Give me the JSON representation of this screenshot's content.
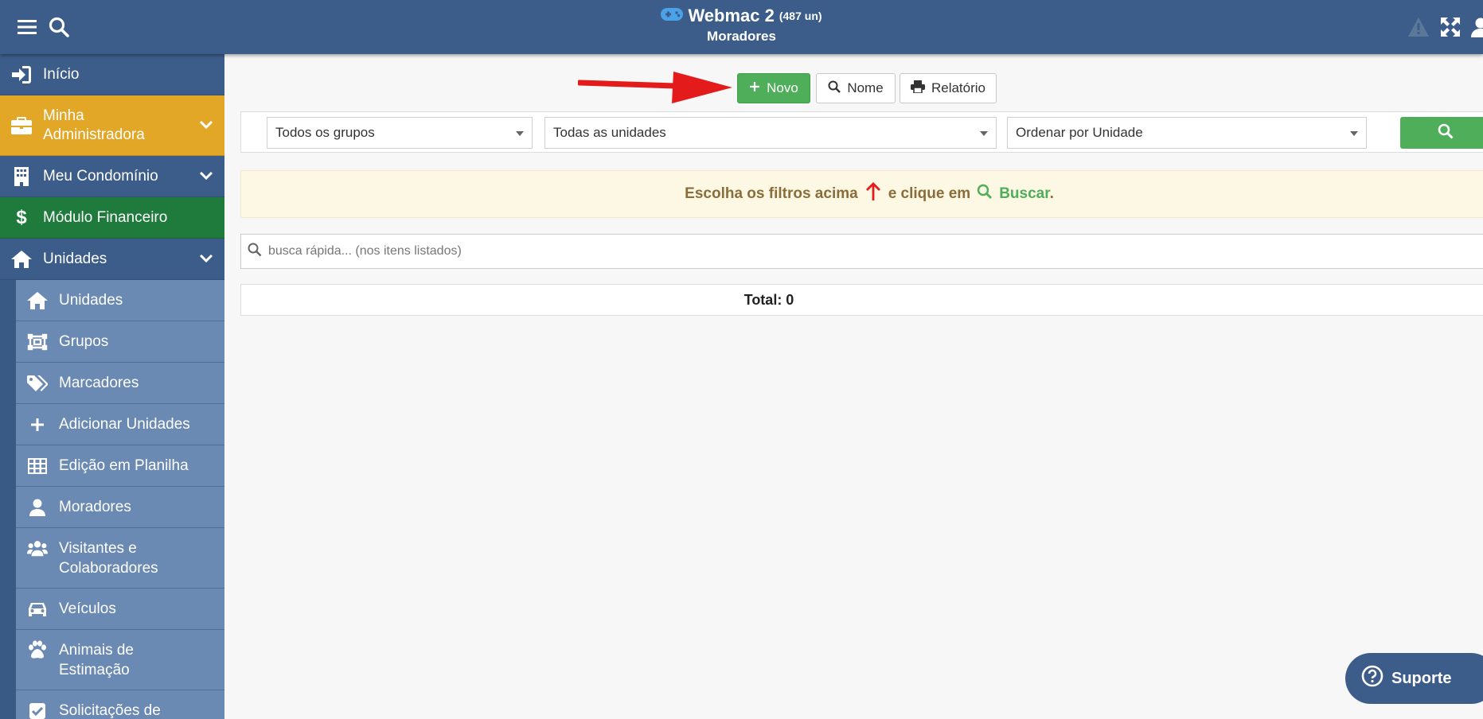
{
  "header": {
    "app_name": "Webmac 2",
    "units_count": "(487 un)",
    "page_title": "Moradores"
  },
  "sidebar": {
    "items": [
      {
        "label": "Início"
      },
      {
        "label": "Minha Administradora"
      },
      {
        "label": "Meu Condomínio"
      },
      {
        "label": "Módulo Financeiro"
      },
      {
        "label": "Unidades"
      }
    ],
    "sub_items": [
      {
        "label": "Unidades"
      },
      {
        "label": "Grupos"
      },
      {
        "label": "Marcadores"
      },
      {
        "label": "Adicionar Unidades"
      },
      {
        "label": "Edição em Planilha"
      },
      {
        "label": "Moradores"
      },
      {
        "label": "Visitantes e Colaboradores"
      },
      {
        "label": "Veículos"
      },
      {
        "label": "Animais de Estimação"
      },
      {
        "label": "Solicitações de"
      }
    ]
  },
  "toolbar": {
    "novo_label": "Novo",
    "nome_label": "Nome",
    "relatorio_label": "Relatório"
  },
  "filters": {
    "grupos": "Todos os grupos",
    "unidades": "Todas as unidades",
    "ordenar": "Ordenar por Unidade"
  },
  "notice": {
    "part1": "Escolha os filtros acima",
    "part2": "e clique em",
    "buscar": "Buscar",
    "period": "."
  },
  "quick_search": {
    "placeholder": "busca rápida... (nos itens listados)"
  },
  "total": {
    "label": "Total: 0"
  },
  "support": {
    "label": "Suporte"
  },
  "colors": {
    "header": "#3c5d8a",
    "admin_item": "#e3a728",
    "finance_item": "#1e7b3c",
    "success": "#4fae5a",
    "arrow": "#e31b1b"
  }
}
